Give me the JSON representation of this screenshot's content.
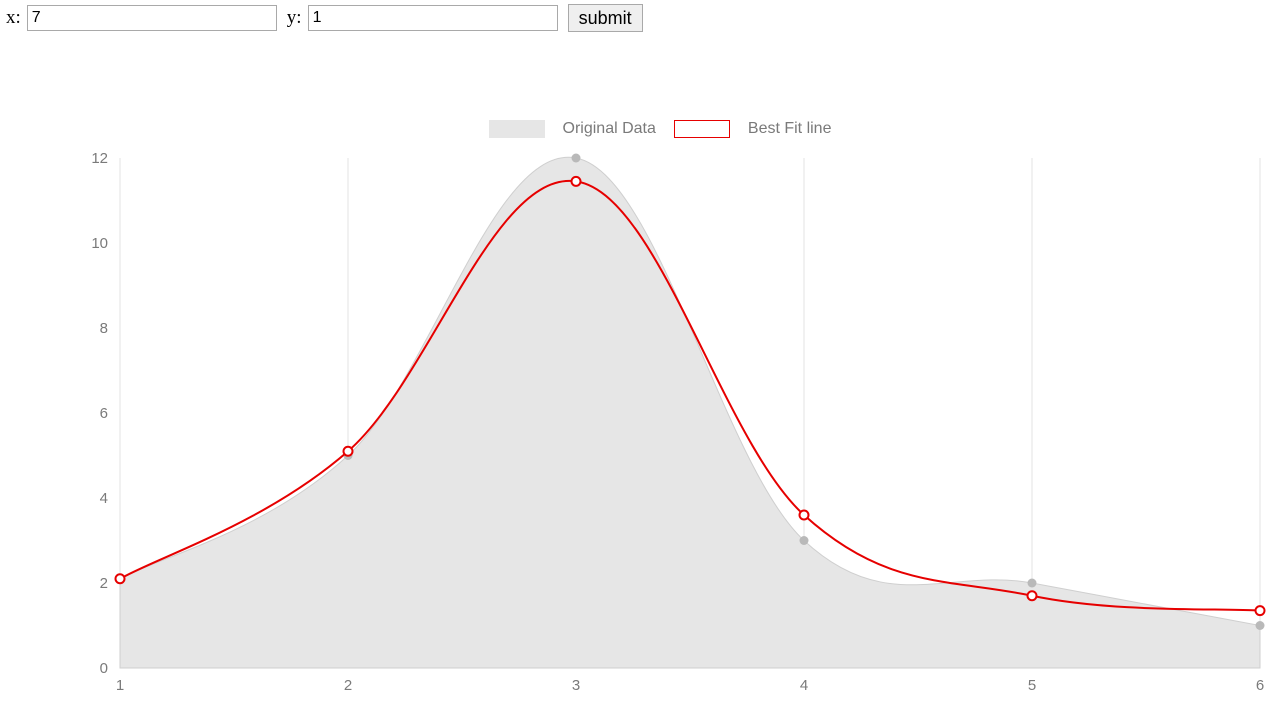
{
  "form": {
    "x_label": "x:",
    "y_label": "y:",
    "x_value": "7",
    "y_value": "1",
    "submit_label": "submit"
  },
  "legend": {
    "original": "Original Data",
    "fit": "Best Fit line"
  },
  "chart_data": {
    "type": "line",
    "x": [
      1,
      2,
      3,
      4,
      5,
      6
    ],
    "series": [
      {
        "name": "Original Data",
        "values": [
          2.1,
          5.0,
          12.0,
          3.0,
          2.0,
          1.0
        ],
        "style": "area"
      },
      {
        "name": "Best Fit line",
        "values": [
          2.1,
          5.1,
          11.45,
          3.6,
          1.7,
          1.35
        ],
        "style": "line",
        "color": "#e60000"
      }
    ],
    "xlabel": "",
    "ylabel": "",
    "x_ticks": [
      1,
      2,
      3,
      4,
      5,
      6
    ],
    "y_ticks": [
      0,
      2,
      4,
      6,
      8,
      10,
      12
    ],
    "xlim": [
      1,
      6
    ],
    "ylim": [
      0,
      12
    ],
    "grid": true
  },
  "colors": {
    "area_fill": "#e6e6e6",
    "grid": "#e3e3e3",
    "fit": "#e60000",
    "tick_text": "#7a7a7a",
    "orig_point": "#b9b9b9"
  }
}
